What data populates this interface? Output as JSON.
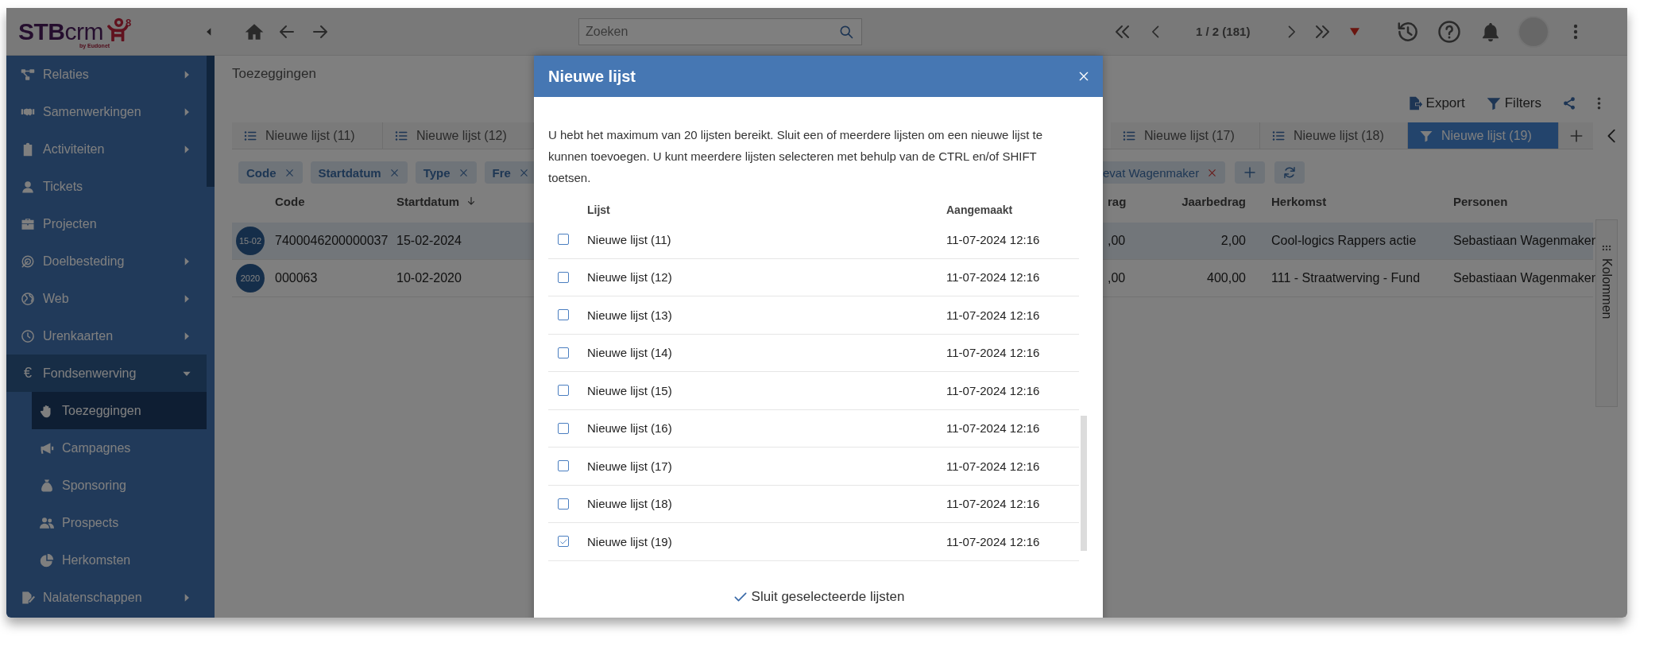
{
  "logo": {
    "brand": "**STB**crm",
    "version": "8",
    "byline": "by Eudonet"
  },
  "sidebar": {
    "items": [
      {
        "label": "Relaties",
        "kind": "group",
        "expanded": false,
        "selected": false
      },
      {
        "label": "Samenwerkingen",
        "kind": "group",
        "expanded": false,
        "selected": false
      },
      {
        "label": "Activiteiten",
        "kind": "group",
        "expanded": false,
        "selected": false
      },
      {
        "label": "Tickets",
        "kind": "link",
        "expanded": false,
        "selected": false
      },
      {
        "label": "Projecten",
        "kind": "link",
        "expanded": false,
        "selected": false
      },
      {
        "label": "Doelbesteding",
        "kind": "group",
        "expanded": false,
        "selected": false
      },
      {
        "label": "Web",
        "kind": "group",
        "expanded": false,
        "selected": false
      },
      {
        "label": "Urenkaarten",
        "kind": "group",
        "expanded": false,
        "selected": false
      },
      {
        "label": "Fondsenwerving",
        "kind": "group",
        "symbol": "€",
        "expanded": true,
        "selected": false,
        "children": [
          {
            "label": "Toezeggingen",
            "selected": true
          },
          {
            "label": "Campagnes",
            "selected": false
          },
          {
            "label": "Sponsoring",
            "selected": false
          },
          {
            "label": "Prospects",
            "selected": false
          },
          {
            "label": "Herkomsten",
            "selected": false
          }
        ]
      },
      {
        "label": "Nalatenschappen",
        "kind": "group",
        "expanded": false,
        "selected": false
      }
    ]
  },
  "topbar": {
    "search": {
      "placeholder": "Zoeken"
    },
    "pager": "1 / 2 (181)"
  },
  "page": {
    "title": "Toezeggingen",
    "actions": [
      "Export",
      "Filters"
    ]
  },
  "tabs": [
    {
      "label": "Nieuwe lijst (11)",
      "kind": "list",
      "selected": false
    },
    {
      "label": "Nieuwe lijst (12)",
      "kind": "list",
      "selected": false
    },
    {
      "label": "Nieuwe lijst (17)",
      "kind": "list",
      "selected": false
    },
    {
      "label": "Nieuwe lijst (18)",
      "kind": "list",
      "selected": false
    },
    {
      "label": "Nieuwe lijst (19)",
      "kind": "filter",
      "selected": true
    }
  ],
  "filter_chips": [
    {
      "label": "Code",
      "kind": "field"
    },
    {
      "label": "Startdatum",
      "kind": "field"
    },
    {
      "label": "Type",
      "kind": "field"
    },
    {
      "label": "Fre",
      "kind": "field"
    },
    {
      "label": "evat Wagenmaker",
      "kind": "condition"
    }
  ],
  "table": {
    "columns": [
      {
        "label": "Code",
        "sort_descending": false
      },
      {
        "label": "Startdatum",
        "sort_descending": true
      },
      {
        "label": "rag",
        "sort_descending": false
      },
      {
        "label": "Jaarbedrag",
        "sort_descending": false
      },
      {
        "label": "Herkomst",
        "sort_descending": false
      },
      {
        "label": "Personen",
        "sort_descending": false
      }
    ],
    "rows": [
      {
        "badge": "15-02",
        "selected": true,
        "cells": [
          "7400046200000037",
          "15-02-2024",
          ",00",
          "2,00",
          "Cool-logics Rappers actie",
          "Sebastiaan Wagenmaker"
        ]
      },
      {
        "badge": "2020",
        "selected": false,
        "cells": [
          "000063",
          "10-02-2020",
          ",00",
          "400,00",
          "111 - Straatwerving - Fund",
          "Sebastiaan Wagenmaker"
        ]
      }
    ]
  },
  "side_panel": {
    "label": "Kolommen"
  },
  "modal": {
    "title": "Nieuwe lijst",
    "message": "U hebt het maximum van 20 lijsten bereikt. Sluit een of meerdere lijsten om een nieuwe lijst te kunnen toevoegen. U kunt meerdere lijsten selecteren met behulp van de CTRL en/of SHIFT toetsen.",
    "columns": [
      "Lijst",
      "Aangemaakt"
    ],
    "rows": [
      {
        "name": "Nieuwe lijst (11)",
        "created": "11-07-2024 12:16",
        "checked": false
      },
      {
        "name": "Nieuwe lijst (12)",
        "created": "11-07-2024 12:16",
        "checked": false
      },
      {
        "name": "Nieuwe lijst (13)",
        "created": "11-07-2024 12:16",
        "checked": false
      },
      {
        "name": "Nieuwe lijst (14)",
        "created": "11-07-2024 12:16",
        "checked": false
      },
      {
        "name": "Nieuwe lijst (15)",
        "created": "11-07-2024 12:16",
        "checked": false
      },
      {
        "name": "Nieuwe lijst (16)",
        "created": "11-07-2024 12:16",
        "checked": false
      },
      {
        "name": "Nieuwe lijst (17)",
        "created": "11-07-2024 12:16",
        "checked": false
      },
      {
        "name": "Nieuwe lijst (18)",
        "created": "11-07-2024 12:16",
        "checked": false
      },
      {
        "name": "Nieuwe lijst (19)",
        "created": "11-07-2024 12:16",
        "checked": true
      }
    ],
    "action": "Sluit geselecteerde lijsten"
  }
}
